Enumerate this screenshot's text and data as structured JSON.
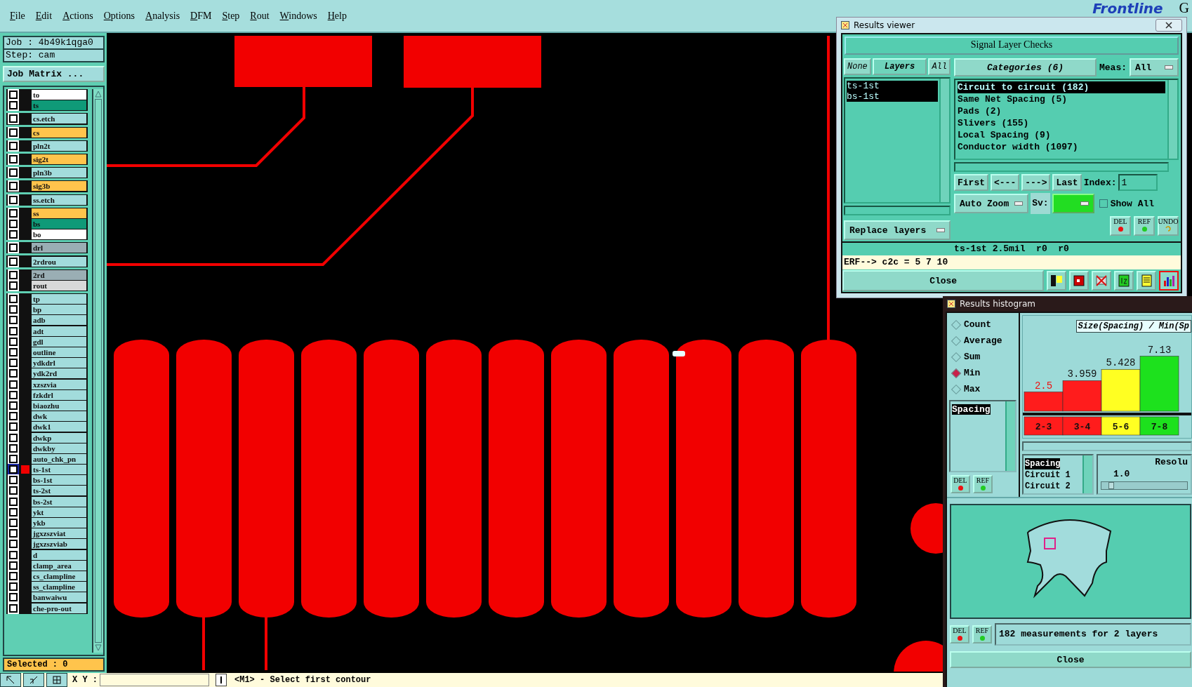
{
  "menu": [
    "File",
    "Edit",
    "Actions",
    "Options",
    "Analysis",
    "DFM",
    "Step",
    "Rout",
    "Windows",
    "Help"
  ],
  "logo": {
    "text": "Frontline",
    "extra": "G"
  },
  "job": {
    "job": "Job : 4b49k1qga0",
    "step": "Step: cam",
    "matrix_button": "Job Matrix ..."
  },
  "layer_groups": [
    [
      {
        "name": "to",
        "color": "#ffffff",
        "checked": false,
        "active": false
      },
      {
        "name": "ts",
        "color": "#0f9a78",
        "checked": false,
        "active": false
      }
    ],
    [
      {
        "name": "cs.etch",
        "color": "#a2dcdc",
        "checked": false,
        "active": false
      }
    ],
    [
      {
        "name": "cs",
        "color": "#ffc44c",
        "checked": false,
        "active": false
      }
    ],
    [
      {
        "name": "pln2t",
        "color": "#a2dcdc",
        "checked": false,
        "active": false
      }
    ],
    [
      {
        "name": "sig2t",
        "color": "#ffc44c",
        "checked": false,
        "active": false
      }
    ],
    [
      {
        "name": "pln3b",
        "color": "#a2dcdc",
        "checked": false,
        "active": false
      }
    ],
    [
      {
        "name": "sig3b",
        "color": "#ffc44c",
        "checked": false,
        "active": false
      }
    ],
    [
      {
        "name": "ss.etch",
        "color": "#a2dcdc",
        "checked": false,
        "active": false
      }
    ],
    [
      {
        "name": "ss",
        "color": "#ffc44c",
        "checked": false,
        "active": false
      },
      {
        "name": "bs",
        "color": "#0f9a78",
        "checked": false,
        "active": false
      },
      {
        "name": "bo",
        "color": "#ffffff",
        "checked": false,
        "active": false
      }
    ],
    [
      {
        "name": "drl",
        "color": "#9aaeb4",
        "checked": false,
        "active": false
      }
    ],
    [
      {
        "name": "2rdrou",
        "color": "#a2dcdc",
        "checked": false,
        "active": false
      }
    ],
    [
      {
        "name": "2rd",
        "color": "#9aaeb4",
        "checked": false,
        "active": false
      },
      {
        "name": "rout",
        "color": "#d8d8d8",
        "checked": false,
        "active": false
      }
    ],
    [
      {
        "name": "tp",
        "color": "#a2dcdc",
        "checked": false,
        "active": false
      },
      {
        "name": "bp",
        "color": "#a2dcdc",
        "checked": false,
        "active": false
      },
      {
        "name": "adb",
        "color": "#a2dcdc",
        "checked": false,
        "active": false
      },
      {
        "name": "adt",
        "color": "#a2dcdc",
        "checked": false,
        "active": false
      },
      {
        "name": "gdl",
        "color": "#a2dcdc",
        "checked": false,
        "active": false
      },
      {
        "name": "outline",
        "color": "#a2dcdc",
        "checked": false,
        "active": false
      },
      {
        "name": "ydkdrl",
        "color": "#a2dcdc",
        "checked": false,
        "active": false
      },
      {
        "name": "ydk2rd",
        "color": "#a2dcdc",
        "checked": false,
        "active": false
      },
      {
        "name": "xzszvia",
        "color": "#a2dcdc",
        "checked": false,
        "active": false
      },
      {
        "name": "fzkdrl",
        "color": "#a2dcdc",
        "checked": false,
        "active": false
      },
      {
        "name": "biaozhu",
        "color": "#a2dcdc",
        "checked": false,
        "active": false
      },
      {
        "name": "dwk",
        "color": "#a2dcdc",
        "checked": false,
        "active": false
      },
      {
        "name": "dwk1",
        "color": "#a2dcdc",
        "checked": false,
        "active": false
      },
      {
        "name": "dwkp",
        "color": "#a2dcdc",
        "checked": false,
        "active": false
      },
      {
        "name": "dwkby",
        "color": "#a2dcdc",
        "checked": false,
        "active": false
      },
      {
        "name": "auto_chk_pn",
        "color": "#a2dcdc",
        "checked": false,
        "active": false
      },
      {
        "name": "ts-1st",
        "color": "#a2dcdc",
        "checked": false,
        "active": true
      },
      {
        "name": "bs-1st",
        "color": "#a2dcdc",
        "checked": false,
        "active": false
      },
      {
        "name": "ts-2st",
        "color": "#a2dcdc",
        "checked": false,
        "active": false
      },
      {
        "name": "bs-2st",
        "color": "#a2dcdc",
        "checked": false,
        "active": false
      },
      {
        "name": "ykt",
        "color": "#a2dcdc",
        "checked": false,
        "active": false
      },
      {
        "name": "ykb",
        "color": "#a2dcdc",
        "checked": false,
        "active": false
      },
      {
        "name": "jgxzszviat",
        "color": "#a2dcdc",
        "checked": false,
        "active": false
      },
      {
        "name": "jgxzszviab",
        "color": "#a2dcdc",
        "checked": false,
        "active": false
      },
      {
        "name": "d",
        "color": "#a2dcdc",
        "checked": false,
        "active": false
      },
      {
        "name": "clamp_area",
        "color": "#a2dcdc",
        "checked": false,
        "active": false
      },
      {
        "name": "cs_clampline",
        "color": "#a2dcdc",
        "checked": false,
        "active": false
      },
      {
        "name": "ss_clampline",
        "color": "#a2dcdc",
        "checked": false,
        "active": false
      },
      {
        "name": "banwaiwu",
        "color": "#a2dcdc",
        "checked": false,
        "active": false
      },
      {
        "name": "che-pro-out",
        "color": "#a2dcdc",
        "checked": false,
        "active": false
      }
    ]
  ],
  "selected_count": "Selected : 0",
  "bottom": {
    "xy_label": "X Y :",
    "prompt": "<M1> - Select first contour"
  },
  "results_viewer": {
    "title": "Results viewer",
    "heading": "Signal Layer Checks",
    "layer_buttons": [
      {
        "label": "None",
        "selected": false
      },
      {
        "label": "Layers",
        "selected": true
      },
      {
        "label": "All",
        "selected": false
      }
    ],
    "layers": [
      {
        "name": "ts-1st",
        "selected": true
      },
      {
        "name": "bs-1st",
        "selected": true
      }
    ],
    "replace": "Replace layers",
    "categories_button": "Categories (6)",
    "meas_label": "Meas:",
    "meas_value": "All",
    "categories": [
      {
        "label": "Circuit to circuit (182)",
        "selected": true
      },
      {
        "label": "Same Net Spacing (5)",
        "selected": false
      },
      {
        "label": "Pads (2)",
        "selected": false
      },
      {
        "label": "Slivers (155)",
        "selected": false
      },
      {
        "label": "Local Spacing (9)",
        "selected": false
      },
      {
        "label": "Conductor width (1097)",
        "selected": false
      }
    ],
    "nav": [
      "First",
      "<---",
      "--->",
      "Last"
    ],
    "index_label": "Index:",
    "index_value": "1",
    "auto_zoom": "Auto Zoom",
    "sv_label": "Sv:",
    "show_all": {
      "label": "Show All",
      "checked": false
    },
    "action_buttons": [
      {
        "label": "DEL",
        "kind": "del"
      },
      {
        "label": "REF",
        "kind": "ref"
      },
      {
        "label": "UNDO",
        "kind": "undo"
      }
    ],
    "status": "ts-1st 2.5mil  r0  r0",
    "erf": "ERF--> c2c = 5 7 10",
    "close": "Close",
    "tools": [
      {
        "kind": "flag",
        "selected": false
      },
      {
        "kind": "delete",
        "selected": false
      },
      {
        "kind": "cross",
        "selected": false
      },
      {
        "kind": "count",
        "selected": false
      },
      {
        "kind": "report",
        "selected": false
      },
      {
        "kind": "histogram",
        "selected": true
      }
    ]
  },
  "histogram": {
    "title": "Results histogram",
    "modes": [
      {
        "label": "Count",
        "selected": false
      },
      {
        "label": "Average",
        "selected": false
      },
      {
        "label": "Sum",
        "selected": false
      },
      {
        "label": "Min",
        "selected": true
      },
      {
        "label": "Max",
        "selected": false
      }
    ],
    "measures": [
      {
        "label": "Spacing",
        "selected": true
      }
    ],
    "buttons": [
      {
        "label": "DEL",
        "kind": "del"
      },
      {
        "label": "REF",
        "kind": "ref"
      }
    ],
    "chart_data": {
      "type": "bar",
      "title": "Size(Spacing) / Min(Sp",
      "categories": [
        "2-3",
        "3-4",
        "5-6",
        "7-8"
      ],
      "data_labels": true,
      "values": [
        2.5,
        3.959,
        5.428,
        7.13
      ]
    },
    "bins": [
      {
        "color": "#ff1c1c"
      },
      {
        "color": "#ff1c1c"
      },
      {
        "color": "#ffff22"
      },
      {
        "color": "#1de11d"
      }
    ],
    "footer_buttons": [
      {
        "label": "DEL",
        "kind": "del"
      },
      {
        "label": "REF",
        "kind": "ref"
      }
    ],
    "fields": [
      {
        "label": "Spacing",
        "selected": true
      },
      {
        "label": "Circuit 1",
        "selected": false
      },
      {
        "label": "Circuit 2",
        "selected": false
      }
    ],
    "resolution_label": "Resolu",
    "resolution_value": "1.0",
    "resolution": {
      "level": 0.08
    },
    "summary": "182 measurements for 2 layers",
    "close": "Close"
  }
}
